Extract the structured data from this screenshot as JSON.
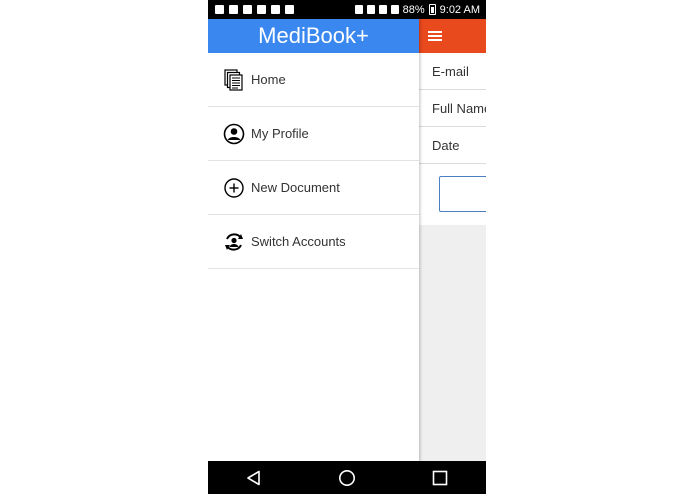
{
  "status_bar": {
    "battery_percent": "88%",
    "time": "9:02 AM"
  },
  "drawer": {
    "title": "MediBook+",
    "items": [
      {
        "label": "Home",
        "icon": "documents-icon"
      },
      {
        "label": "My Profile",
        "icon": "profile-icon"
      },
      {
        "label": "New Document",
        "icon": "add-circle-icon"
      },
      {
        "label": "Switch Accounts",
        "icon": "switch-accounts-icon"
      }
    ]
  },
  "background_form": {
    "fields": [
      "E-mail",
      "Full Name",
      "Date"
    ]
  },
  "colors": {
    "drawer_header": "#3a87f0",
    "app_header": "#e8491d"
  }
}
